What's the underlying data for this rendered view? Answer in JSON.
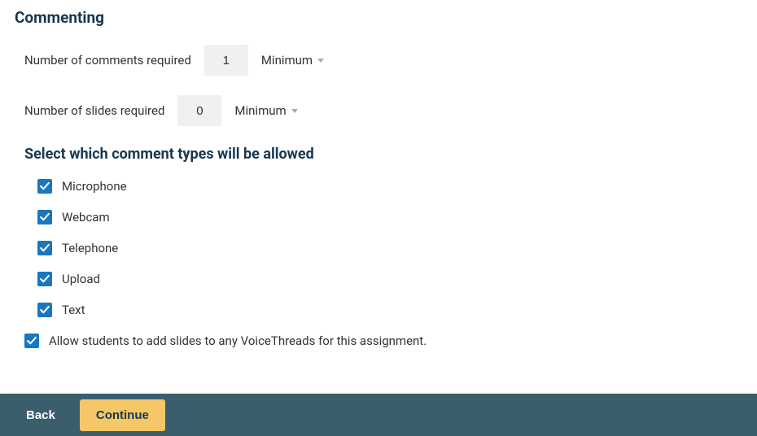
{
  "heading": "Commenting",
  "comments": {
    "label": "Number of comments required",
    "value": "1",
    "mode": "Minimum"
  },
  "slides": {
    "label": "Number of slides required",
    "value": "0",
    "mode": "Minimum"
  },
  "subheading": "Select which comment types will be allowed",
  "types": {
    "microphone": "Microphone",
    "webcam": "Webcam",
    "telephone": "Telephone",
    "upload": "Upload",
    "text": "Text"
  },
  "allowSlides": "Allow students to add slides to any VoiceThreads for this assignment.",
  "footer": {
    "back": "Back",
    "continue": "Continue"
  }
}
